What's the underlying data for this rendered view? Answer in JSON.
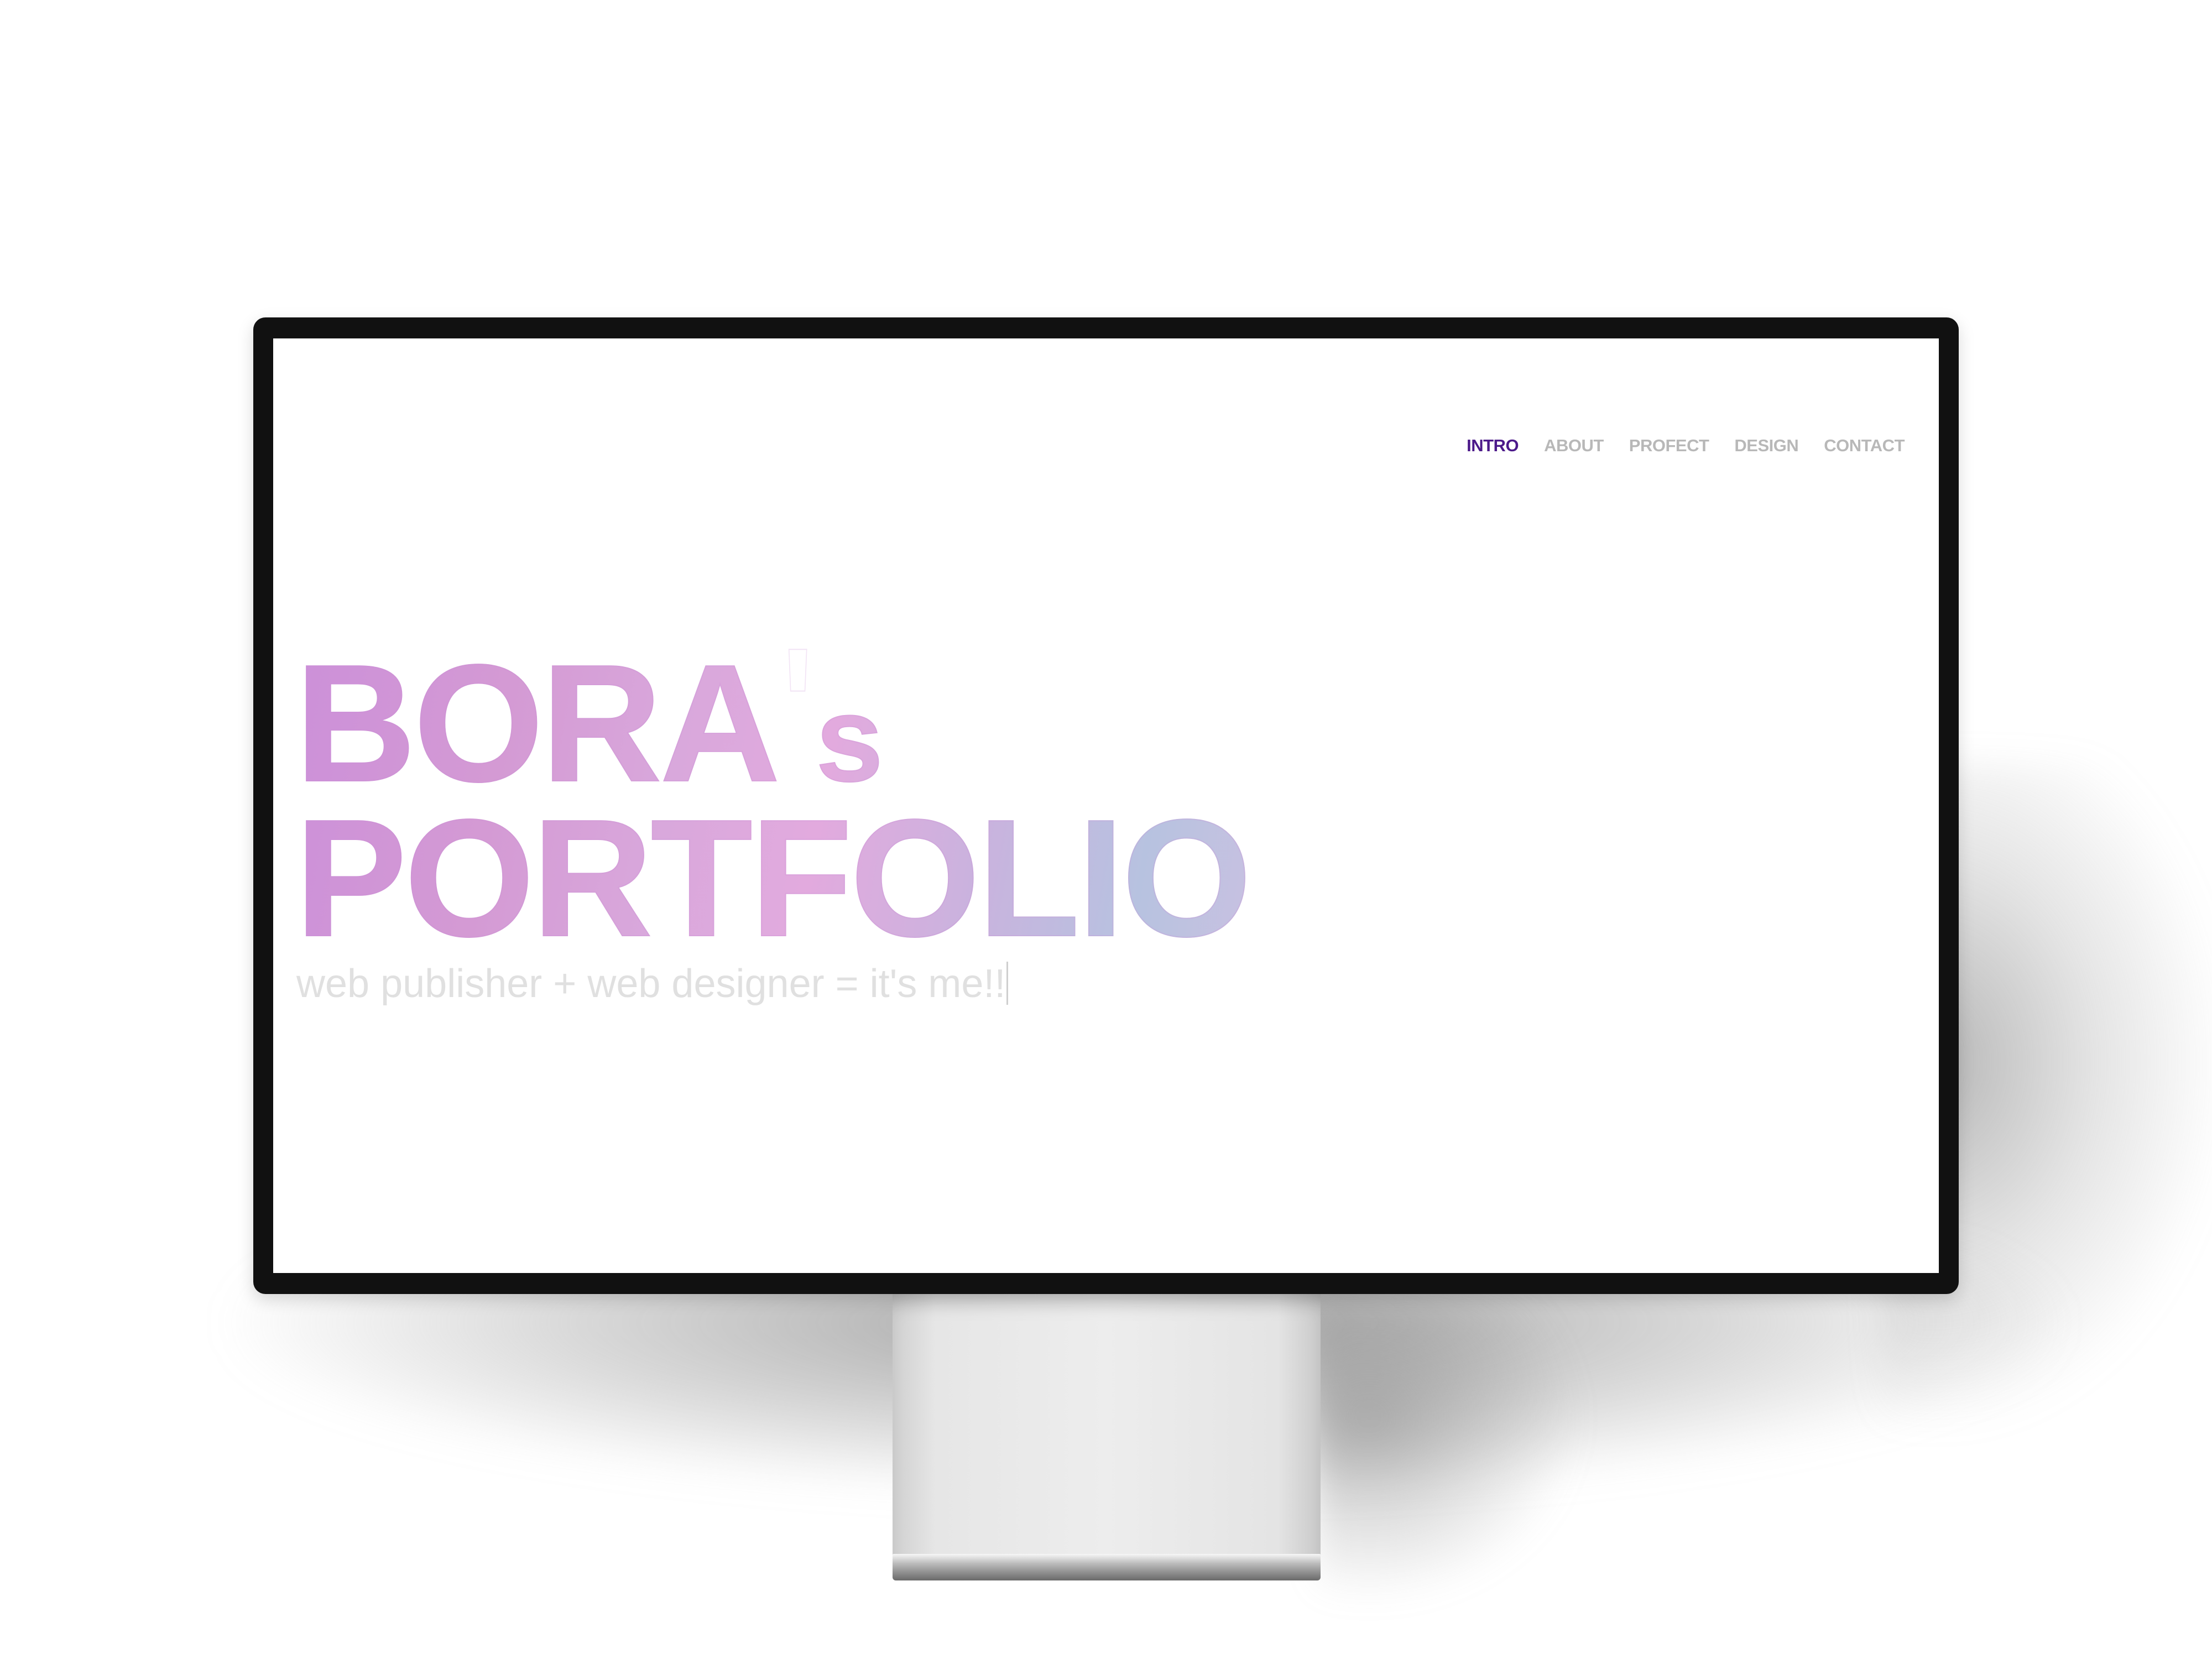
{
  "nav": {
    "items": [
      {
        "label": "INTRO",
        "active": true
      },
      {
        "label": "ABOUT",
        "active": false
      },
      {
        "label": "PROFECT",
        "active": false
      },
      {
        "label": "DESIGN",
        "active": false
      },
      {
        "label": "CONTACT",
        "active": false
      }
    ]
  },
  "hero": {
    "title_line1_main": "BORA",
    "title_line1_apostrophe": "'",
    "title_line1_suffix": "s",
    "title_line2": "PORTFOLIO",
    "tagline": "web publisher + web designer = it's me!!"
  },
  "colors": {
    "nav_active": "#4c1a8a",
    "nav_inactive": "#b8b8b8",
    "title_gradient_start": "#cc90d9",
    "title_gradient_end": "#b7c2e0",
    "tagline": "#e0e0e0"
  }
}
